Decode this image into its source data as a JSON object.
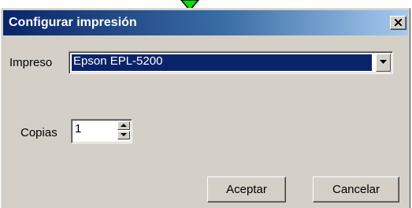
{
  "window": {
    "title": "Configurar impresión"
  },
  "printer": {
    "label": "Impreso",
    "selected": "Epson EPL-5200"
  },
  "copies": {
    "label": "Copias",
    "value": "1"
  },
  "buttons": {
    "accept": "Aceptar",
    "cancel": "Cancelar"
  },
  "colors": {
    "titlebar_start": "#0a246a",
    "titlebar_end": "#a6caf0",
    "dialog_bg": "#d4d0c8",
    "selection": "#0a246a",
    "pointer": "#00e000"
  },
  "icons": {
    "close": "close-icon",
    "dropdown": "chevron-down-icon",
    "spin_up": "spin-up-icon",
    "spin_down": "spin-down-icon",
    "pointer": "arrow-pointer-icon"
  }
}
